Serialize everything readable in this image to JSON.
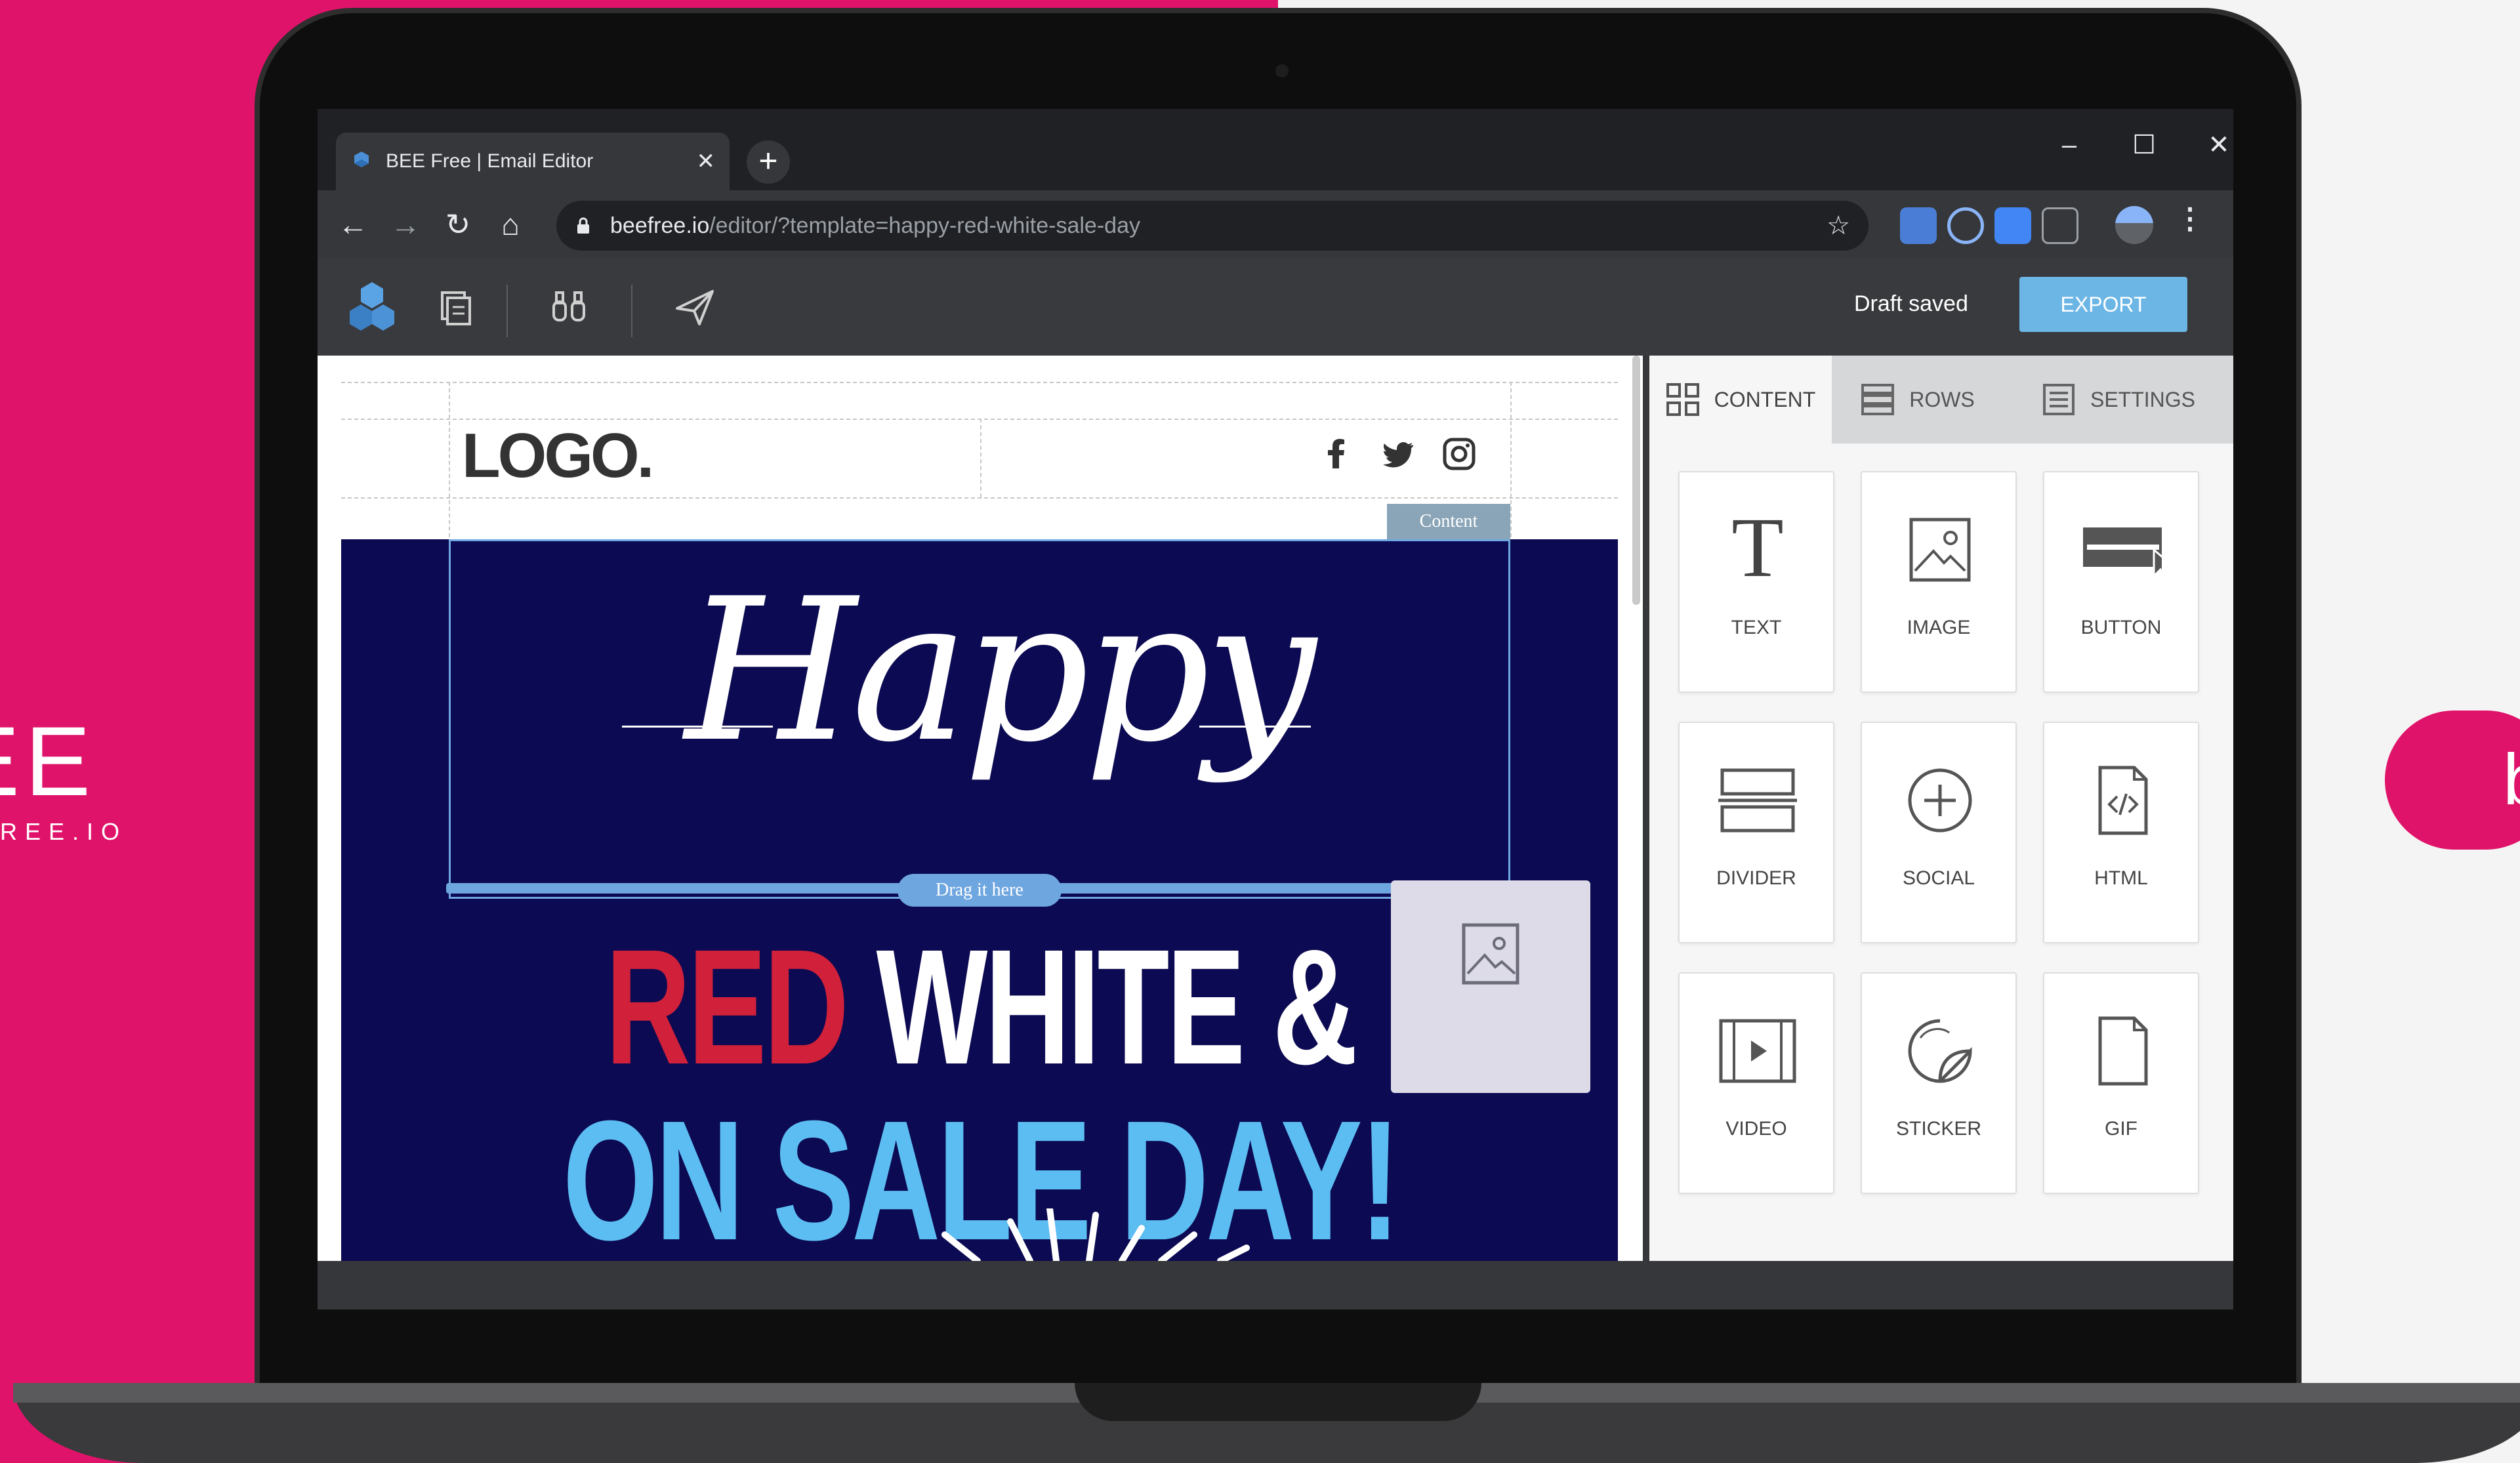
{
  "page": {
    "brand_name": "EE",
    "brand_url": "REE.IO",
    "cta_text": "b"
  },
  "browser": {
    "tab_title": "BEE Free | Email Editor",
    "url_host": "beefree.io",
    "url_path": "/editor/?template=happy-red-white-sale-day"
  },
  "editor": {
    "draft_status": "Draft saved",
    "export_label": "EXPORT"
  },
  "email": {
    "logo_text": "LOGO.",
    "content_tag": "Content",
    "script_heading": "Happy",
    "drag_hint": "Drag it here",
    "headline_red": "RED",
    "headline_white": "WHITE &",
    "headline_line2": "ON SALE DAY!"
  },
  "panel": {
    "tabs": [
      {
        "label": "CONTENT",
        "icon": "grid-icon"
      },
      {
        "label": "ROWS",
        "icon": "rows-icon"
      },
      {
        "label": "SETTINGS",
        "icon": "settings-icon"
      }
    ],
    "blocks": [
      {
        "label": "TEXT",
        "icon": "text-icon"
      },
      {
        "label": "IMAGE",
        "icon": "image-icon"
      },
      {
        "label": "BUTTON",
        "icon": "button-icon"
      },
      {
        "label": "DIVIDER",
        "icon": "divider-icon"
      },
      {
        "label": "SOCIAL",
        "icon": "social-icon"
      },
      {
        "label": "HTML",
        "icon": "html-icon"
      },
      {
        "label": "VIDEO",
        "icon": "video-icon"
      },
      {
        "label": "STICKER",
        "icon": "sticker-icon"
      },
      {
        "label": "GIF",
        "icon": "gif-icon"
      }
    ]
  },
  "colors": {
    "brand_pink": "#e0136a",
    "hero_navy": "#0c0a52",
    "headline_red": "#d0203a",
    "headline_blue": "#5cbdf2",
    "export_blue": "#6cb6e6"
  }
}
